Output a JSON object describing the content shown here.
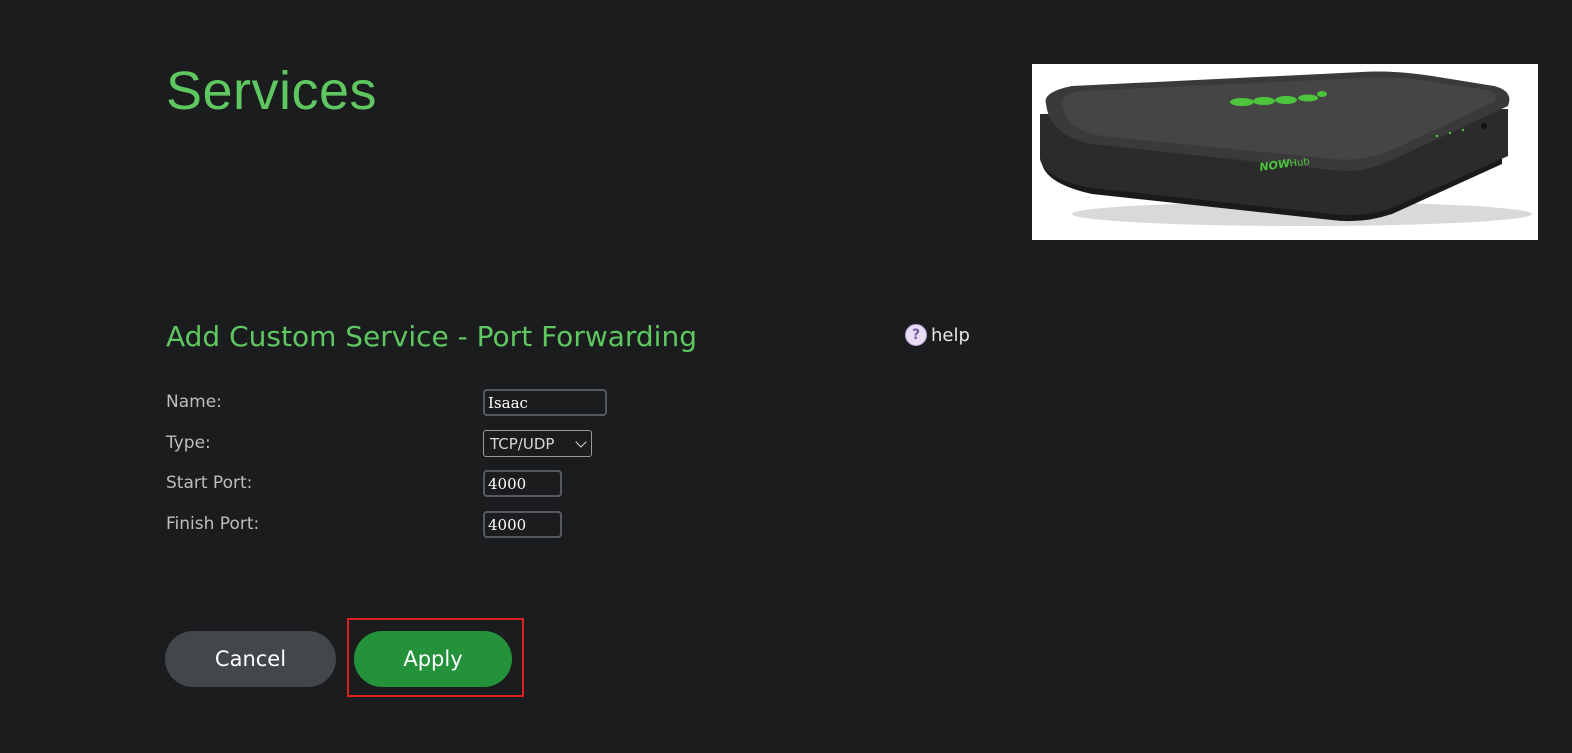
{
  "page": {
    "title": "Services"
  },
  "hero": {
    "image_alt": "NOW Hub router",
    "brand_text": "NOW",
    "product_text": "Hub"
  },
  "section": {
    "title": "Add Custom Service - Port Forwarding",
    "help_label": "help",
    "help_icon_glyph": "?"
  },
  "form": {
    "name": {
      "label": "Name:",
      "value": "Isaac"
    },
    "type": {
      "label": "Type:",
      "value": "TCP/UDP"
    },
    "start_port": {
      "label": "Start Port:",
      "value": "4000"
    },
    "finish_port": {
      "label": "Finish Port:",
      "value": "4000"
    }
  },
  "buttons": {
    "cancel": "Cancel",
    "apply": "Apply"
  },
  "colors": {
    "accent_green": "#5fc760",
    "apply_green": "#24923b",
    "highlight_red": "#e01f1f"
  }
}
